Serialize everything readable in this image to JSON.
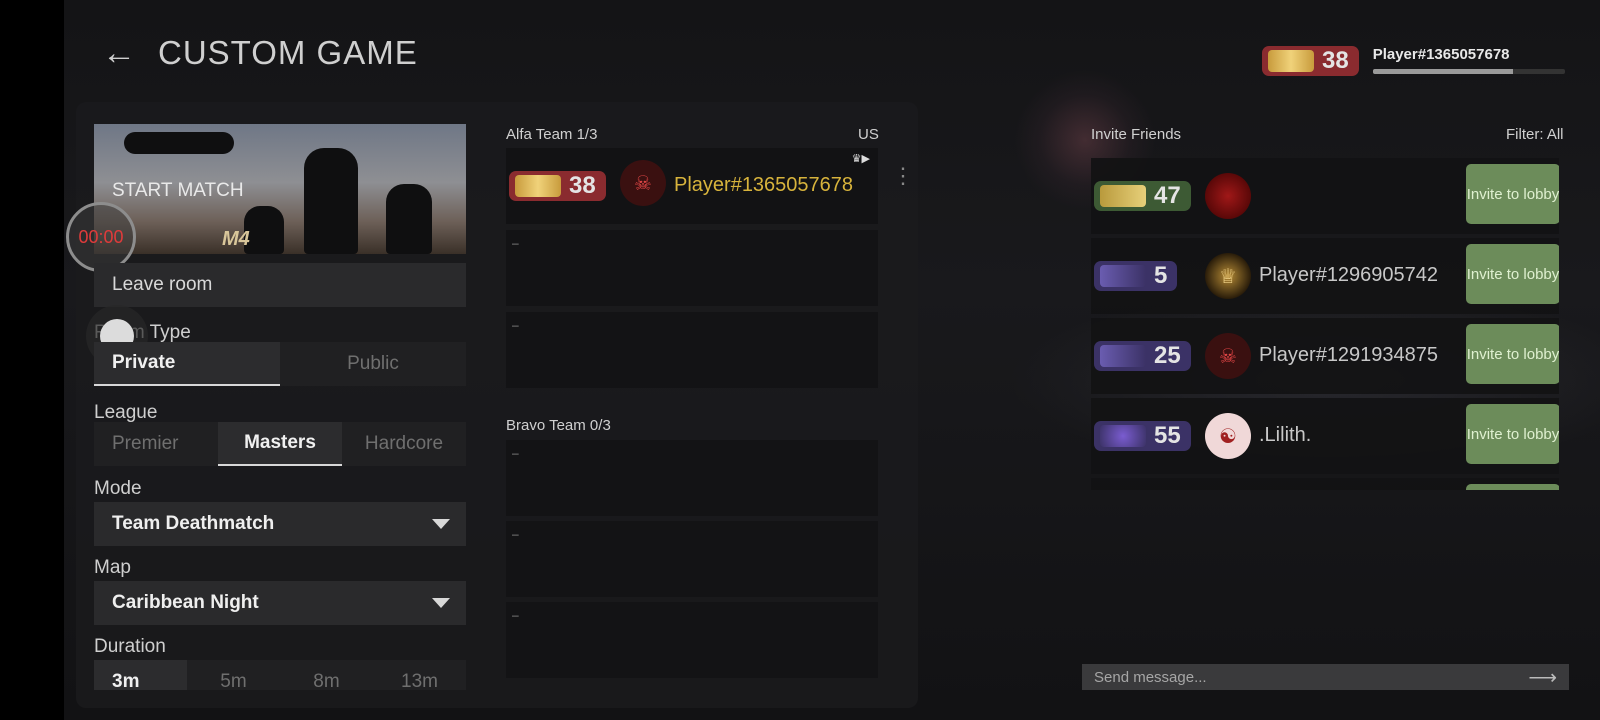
{
  "header": {
    "back_icon": "arrow-left-icon",
    "title": "CUSTOM GAME"
  },
  "profile": {
    "rank": "38",
    "rank_color": "#8a2b2f",
    "name": "Player#1365057678",
    "xp_fraction": 0.73
  },
  "match": {
    "start_label": "START MATCH",
    "logo_text": "M4",
    "timer": "00:00",
    "leave_label": "Leave room"
  },
  "room_type": {
    "label": "Room Type",
    "options": [
      "Private",
      "Public"
    ],
    "selected": "Private"
  },
  "league": {
    "label": "League",
    "options": [
      "Premier",
      "Masters",
      "Hardcore"
    ],
    "selected": "Masters"
  },
  "mode": {
    "label": "Mode",
    "value": "Team Deathmatch"
  },
  "map": {
    "label": "Map",
    "value": "Caribbean Night"
  },
  "duration": {
    "label": "Duration",
    "options": [
      "3m",
      "5m",
      "8m",
      "13m"
    ],
    "selected": "3m"
  },
  "alfa_team": {
    "label": "Alfa Team 1/3",
    "region": "US",
    "player": {
      "rank": "38",
      "rank_color": "#8a2b2f",
      "name": "Player#1365057678",
      "avatar": "skull-hood-icon"
    },
    "empty_slot": "–"
  },
  "bravo_team": {
    "label": "Bravo Team 0/3",
    "empty_slot": "–"
  },
  "invite": {
    "title": "Invite Friends",
    "filter": "Filter: All",
    "button_label": "Invite to lobby",
    "friends": [
      {
        "rank": "47",
        "rank_color": "#3d5a34",
        "name": "",
        "avatar": "red-orb-avatar"
      },
      {
        "rank": "5",
        "rank_color": "#3b3266",
        "name": "Player#1296905742",
        "avatar": "lion-avatar"
      },
      {
        "rank": "25",
        "rank_color": "#3b3266",
        "name": "Player#1291934875",
        "avatar": "skull-hood-avatar"
      },
      {
        "rank": "55",
        "rank_color": "#3b3266",
        "name": ".Lilith.",
        "avatar": "cat-scream-avatar"
      }
    ]
  },
  "chat": {
    "placeholder": "Send message...",
    "send_icon": "arrow-right-icon"
  }
}
